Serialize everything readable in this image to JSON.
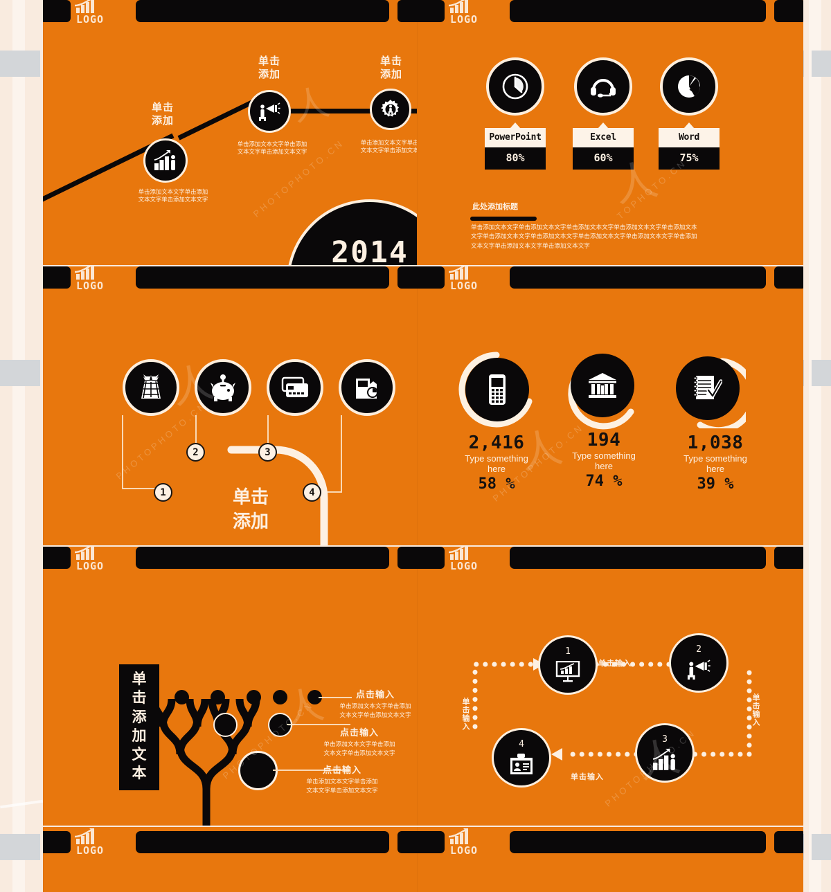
{
  "theme": {
    "orange": "#e8770d",
    "black": "#0a0809",
    "cream": "#fdf0e2",
    "paper": "#f9ebdf",
    "gray_band": "#d3d6d9"
  },
  "logo": {
    "text": "LOGO",
    "icon": "bar-chart-arrow-icon"
  },
  "slides": [
    {
      "id": "timeline",
      "position": "top-left",
      "year_badge": "2014",
      "nodes": [
        {
          "kicker": "单击\n添加",
          "kicker_lines": [
            "单击",
            "添加"
          ],
          "icon": "growth-chart-person-icon",
          "body_lines": [
            "单击添加文本文字单击添加",
            "文本文字单击添加文本文字"
          ]
        },
        {
          "kicker_lines": [
            "单击",
            "添加"
          ],
          "icon": "megaphone-person-icon",
          "body_lines": [
            "单击添加文本文字单击添加",
            "文本文字单击添加文本文字"
          ]
        },
        {
          "kicker_lines": [
            "单击",
            "添加"
          ],
          "icon": "gear-person-icon",
          "body_lines": [
            "单击添加文本文字单击添加",
            "文本文字单击添加文本文字"
          ]
        }
      ]
    },
    {
      "id": "skills",
      "position": "top-right",
      "skills": [
        {
          "icon": "clock-icon",
          "name": "PowerPoint",
          "percent": "80%",
          "value": 80
        },
        {
          "icon": "headset-icon",
          "name": "Excel",
          "percent": "60%",
          "value": 60
        },
        {
          "icon": "pie-chart-icon",
          "name": "Word",
          "percent": "75%",
          "value": 75
        }
      ],
      "section_title": "此处添加标题",
      "body_lines": [
        "单击添加文本文字单击添加文本文字单击添加文本文字单击添加文本文字单击添加文本",
        "文字单击添加文本文字单击添加文本文字单击添加文本文字单击添加文本文字单击添加",
        "文本文字单击添加文本文字单击添加文本文字"
      ]
    },
    {
      "id": "money-steps",
      "position": "middle-left",
      "center_lines": [
        "单击",
        "添加"
      ],
      "items": [
        {
          "icon": "money-bag-icon",
          "number": "1"
        },
        {
          "icon": "piggy-bank-icon",
          "number": "2"
        },
        {
          "icon": "credit-card-icon",
          "number": "3"
        },
        {
          "icon": "wallet-coin-icon",
          "number": "4"
        }
      ]
    },
    {
      "id": "stats",
      "position": "middle-right",
      "stats": [
        {
          "icon": "mobile-phone-icon",
          "number": "2,416",
          "label_lines": [
            "Type something",
            "here"
          ],
          "percent": "58 %",
          "value": 58
        },
        {
          "icon": "bank-icon",
          "number": "194",
          "label_lines": [
            "Type something",
            "here"
          ],
          "percent": "74 %",
          "value": 74
        },
        {
          "icon": "checklist-icon",
          "number": "1,038",
          "label_lines": [
            "Type something",
            "here"
          ],
          "percent": "39 %",
          "value": 39
        }
      ]
    },
    {
      "id": "tree",
      "position": "bottom-left",
      "tag_lines": [
        "单击",
        "添加",
        "文本"
      ],
      "items": [
        {
          "heading": "点击输入",
          "body_lines": [
            "单击添加文本文字单击添加",
            "文本文字单击添加文本文字"
          ]
        },
        {
          "heading": "点击输入",
          "body_lines": [
            "单击添加文本文字单击添加",
            "文本文字单击添加文本文字"
          ]
        },
        {
          "heading": "点击输入",
          "body_lines": [
            "单击添加文本文字单击添加",
            "文本文字单击添加文本文字"
          ]
        }
      ]
    },
    {
      "id": "cycle",
      "position": "bottom-right",
      "nodes": [
        {
          "number": "1",
          "icon": "presentation-chart-icon"
        },
        {
          "number": "2",
          "icon": "megaphone-person-icon"
        },
        {
          "number": "3",
          "icon": "growth-chart-person-icon"
        },
        {
          "number": "4",
          "icon": "id-badge-icon"
        }
      ],
      "connector_labels": {
        "top": "单击输入",
        "right": "单击输入",
        "bottom": "单击输入",
        "left": "单击输入"
      }
    },
    {
      "id": "partial-left",
      "position": "bottom-strip-left"
    },
    {
      "id": "partial-right",
      "position": "bottom-strip-right"
    }
  ],
  "watermarks": {
    "site": "PHOTOPHOTO.CN",
    "short": "TOPHOTO.CN"
  }
}
